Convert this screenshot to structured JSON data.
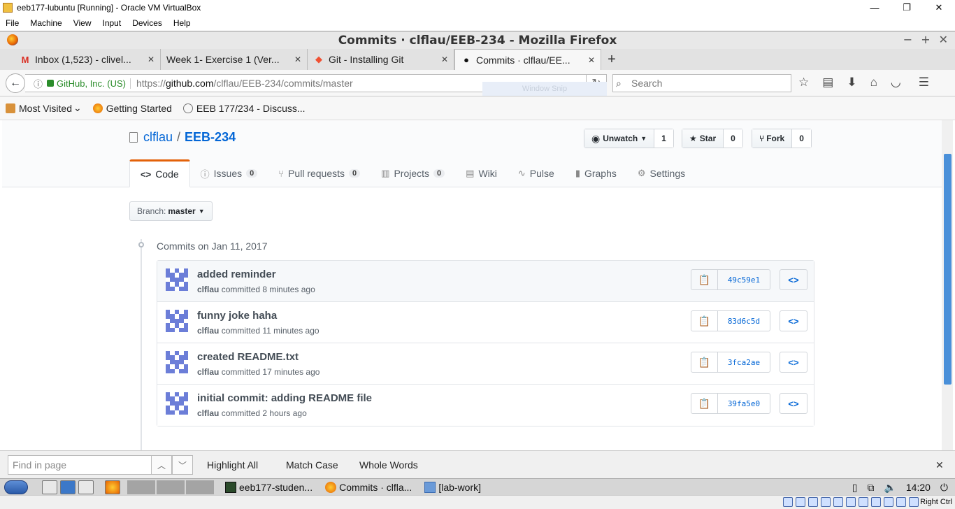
{
  "vbox": {
    "title": "eeb177-lubuntu [Running] - Oracle VM VirtualBox",
    "menu": [
      "File",
      "Machine",
      "View",
      "Input",
      "Devices",
      "Help"
    ],
    "host_key": "Right Ctrl"
  },
  "firefox": {
    "window_title": "Commits · clflau/EEB-234 - Mozilla Firefox",
    "tabs": [
      {
        "label": "Inbox (1,523) - clivel...",
        "icon": "gmail-icon"
      },
      {
        "label": "Week 1- Exercise 1 (Ver...",
        "icon": "doc-icon"
      },
      {
        "label": "Git - Installing Git",
        "icon": "git-icon"
      },
      {
        "label": "Commits · clflau/EE...",
        "icon": "github-icon",
        "active": true
      }
    ],
    "url": {
      "identity": "GitHub, Inc. (US)",
      "prefix": "https://",
      "host": "github.com",
      "path": "/clflau/EEB-234/commits/master"
    },
    "search_placeholder": "Search",
    "snip_ghost": "Window Snip",
    "bookmarks": [
      "Most Visited",
      "Getting Started",
      "EEB 177/234 - Discuss..."
    ]
  },
  "repo": {
    "owner": "clflau",
    "separator": "/",
    "name": "EEB-234",
    "social": {
      "watch_label": "Unwatch",
      "watch_count": "1",
      "star_label": "Star",
      "star_count": "0",
      "fork_label": "Fork",
      "fork_count": "0"
    },
    "nav": [
      {
        "label": "Code",
        "icon": "<>",
        "selected": true
      },
      {
        "label": "Issues",
        "icon": "ⓘ",
        "counter": "0"
      },
      {
        "label": "Pull requests",
        "icon": "⑂",
        "counter": "0"
      },
      {
        "label": "Projects",
        "icon": "▥",
        "counter": "0"
      },
      {
        "label": "Wiki",
        "icon": "▤"
      },
      {
        "label": "Pulse",
        "icon": "∿"
      },
      {
        "label": "Graphs",
        "icon": "▮"
      },
      {
        "label": "Settings",
        "icon": "⚙"
      }
    ],
    "branch_label": "Branch:",
    "branch": "master"
  },
  "commits_group": {
    "title": "Commits on Jan 11, 2017",
    "items": [
      {
        "message": "added reminder",
        "author": "clflau",
        "verb": "committed",
        "when": "8 minutes ago",
        "sha": "49c59e1"
      },
      {
        "message": "funny joke haha",
        "author": "clflau",
        "verb": "committed",
        "when": "11 minutes ago",
        "sha": "83d6c5d"
      },
      {
        "message": "created README.txt",
        "author": "clflau",
        "verb": "committed",
        "when": "17 minutes ago",
        "sha": "3fca2ae"
      },
      {
        "message": "initial commit: adding README file",
        "author": "clflau",
        "verb": "committed",
        "when": "2 hours ago",
        "sha": "39fa5e0"
      }
    ]
  },
  "findbar": {
    "placeholder": "Find in page",
    "highlight_all": "Highlight All",
    "match_case": "Match Case",
    "whole_words": "Whole Words"
  },
  "taskbar": {
    "tasks": [
      "eeb177-studen...",
      "Commits · clfla...",
      "[lab-work]"
    ],
    "clock": "14:20"
  },
  "colors": {
    "link": "#0366d6",
    "selected_tab_accent": "#e36209",
    "avatar": "#6c7ed8",
    "scroll_thumb": "#4a90d9"
  }
}
